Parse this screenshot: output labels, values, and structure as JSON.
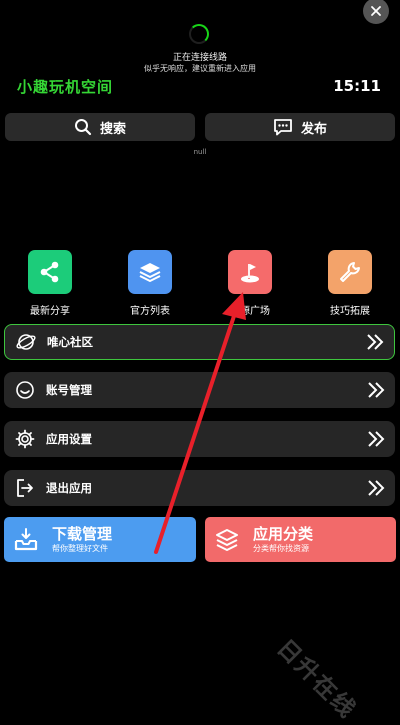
{
  "status": {
    "connecting": "正在连接线路",
    "hint": "似乎无响应，建议重新进入应用"
  },
  "header": {
    "title": "小趣玩机空间",
    "time": "15:11"
  },
  "toolbar": {
    "search_label": "搜索",
    "publish_label": "发布"
  },
  "notice": "null",
  "grid": [
    {
      "label": "最新分享",
      "icon": "share-icon",
      "color": "#1ccc7a"
    },
    {
      "label": "官方列表",
      "icon": "layers-icon",
      "color": "#4f94f0"
    },
    {
      "label": "资源广场",
      "icon": "location-flag-icon",
      "color": "#f56b6b"
    },
    {
      "label": "技巧拓展",
      "icon": "wrench-icon",
      "color": "#f3a36a"
    }
  ],
  "menu": [
    {
      "label": "唯心社区",
      "icon": "planet-icon"
    },
    {
      "label": "账号管理",
      "icon": "smiley-icon"
    },
    {
      "label": "应用设置",
      "icon": "gear-icon"
    },
    {
      "label": "退出应用",
      "icon": "exit-icon"
    }
  ],
  "cards": {
    "download": {
      "title": "下载管理",
      "subtitle": "帮你整理好文件",
      "color": "#4c9cf0"
    },
    "categories": {
      "title": "应用分类",
      "subtitle": "分类帮你找资源",
      "color": "#f26a6a"
    }
  },
  "watermark": "日升在线",
  "colors": {
    "accent_green": "#35d635",
    "annotation_arrow": "#e8202a"
  }
}
